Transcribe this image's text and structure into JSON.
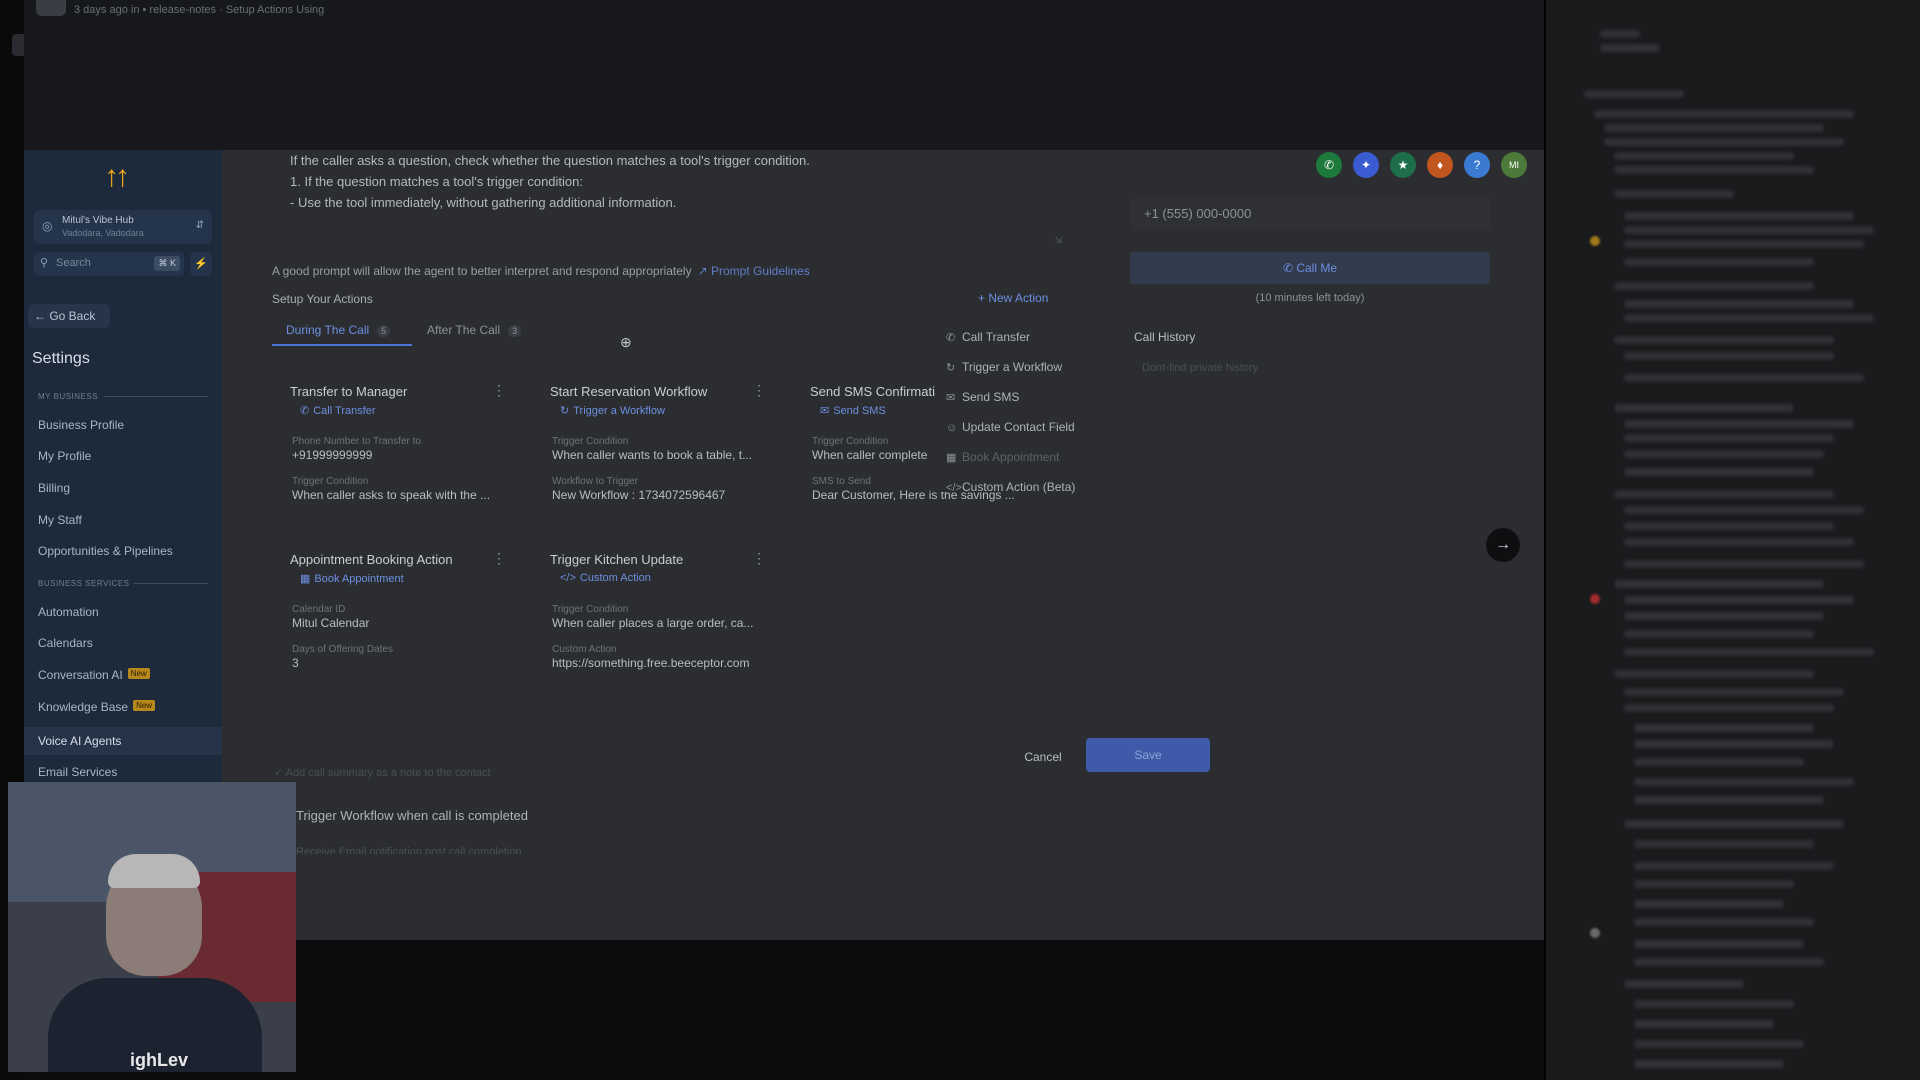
{
  "topbar": {
    "meta": "3 days ago in • release-notes · Setup Actions Using"
  },
  "sidebar": {
    "logo": "↑↑",
    "location": {
      "name": "Mitul's Vibe Hub",
      "sub": "Vadodara, Vadodara"
    },
    "search_placeholder": "Search",
    "search_kbd": "⌘ K",
    "go_back": "← Go Back",
    "settings_title": "Settings",
    "section_my_business": "MY BUSINESS",
    "section_business_services": "BUSINESS SERVICES",
    "items_my_business": [
      "Business Profile",
      "My Profile",
      "Billing",
      "My Staff",
      "Opportunities & Pipelines"
    ],
    "items_business_services": [
      "Automation",
      "Calendars",
      "Conversation AI",
      "Knowledge Base",
      "Voice AI Agents",
      "Email Services"
    ],
    "new_badge": "New"
  },
  "main": {
    "prompt_lines": [
      "If the caller asks a question, check whether the question matches a tool's trigger condition.",
      "1. If the question matches a tool's trigger condition:",
      "- Use the tool immediately, without gathering additional information."
    ],
    "prompt_hint": "A good prompt will allow the agent to better interpret and respond appropriately",
    "prompt_guide": "Prompt Guidelines",
    "setup_label": "Setup Your Actions",
    "new_action": "+ New Action",
    "tabs": [
      {
        "label": "During The Call",
        "count": "5"
      },
      {
        "label": "After The Call",
        "count": "3"
      }
    ],
    "cards": [
      {
        "title": "Transfer to Manager",
        "type": "Call Transfer",
        "l1": "Phone Number to Transfer to",
        "v1": "+91999999999",
        "l2": "Trigger Condition",
        "v2": "When caller asks to speak with the ..."
      },
      {
        "title": "Start Reservation Workflow",
        "type": "Trigger a Workflow",
        "l1": "Trigger Condition",
        "v1": "When caller wants to book a table, t...",
        "l2": "Workflow to Trigger",
        "v2": "New Workflow : 1734072596467"
      },
      {
        "title": "Send SMS Confirmati",
        "type": "Send SMS",
        "l1": "Trigger Condition",
        "v1": "When caller complete",
        "l2": "SMS to Send",
        "v2": "Dear Customer, Here is the savings ..."
      },
      {
        "title": "Appointment Booking Action",
        "type": "Book Appointment",
        "l1": "Calendar ID",
        "v1": "Mitul Calendar",
        "l2": "Days of Offering Dates",
        "v2": "3"
      },
      {
        "title": "Trigger Kitchen Update",
        "type": "Custom Action",
        "l1": "Trigger Condition",
        "v1": "When caller places a large order, ca...",
        "l2": "Custom Action",
        "v2": "https://something.free.beeceptor.com"
      }
    ],
    "dropdown": [
      "Call Transfer",
      "Trigger a Workflow",
      "Send SMS",
      "Update Contact Field",
      "Book Appointment",
      "Custom Action (Beta)"
    ],
    "summary_row": "Add call summary as a note to the contact",
    "trigger_row": "Trigger Workflow when call is completed",
    "email_row": "Receive Email notification post call completion",
    "cancel": "Cancel",
    "save": "Save"
  },
  "call": {
    "phone_placeholder": "+1 (555) 000-0000",
    "call_me": "Call Me",
    "minutes_left": "(10 minutes left today)",
    "history_title": "Call History",
    "history_empty": "Dont-find private history"
  },
  "webcam": {
    "watermark": "ighLev"
  },
  "colors": {
    "accent": "#4e73d6",
    "sidebar": "#1d2a3b",
    "logo": "#e8a21f"
  }
}
